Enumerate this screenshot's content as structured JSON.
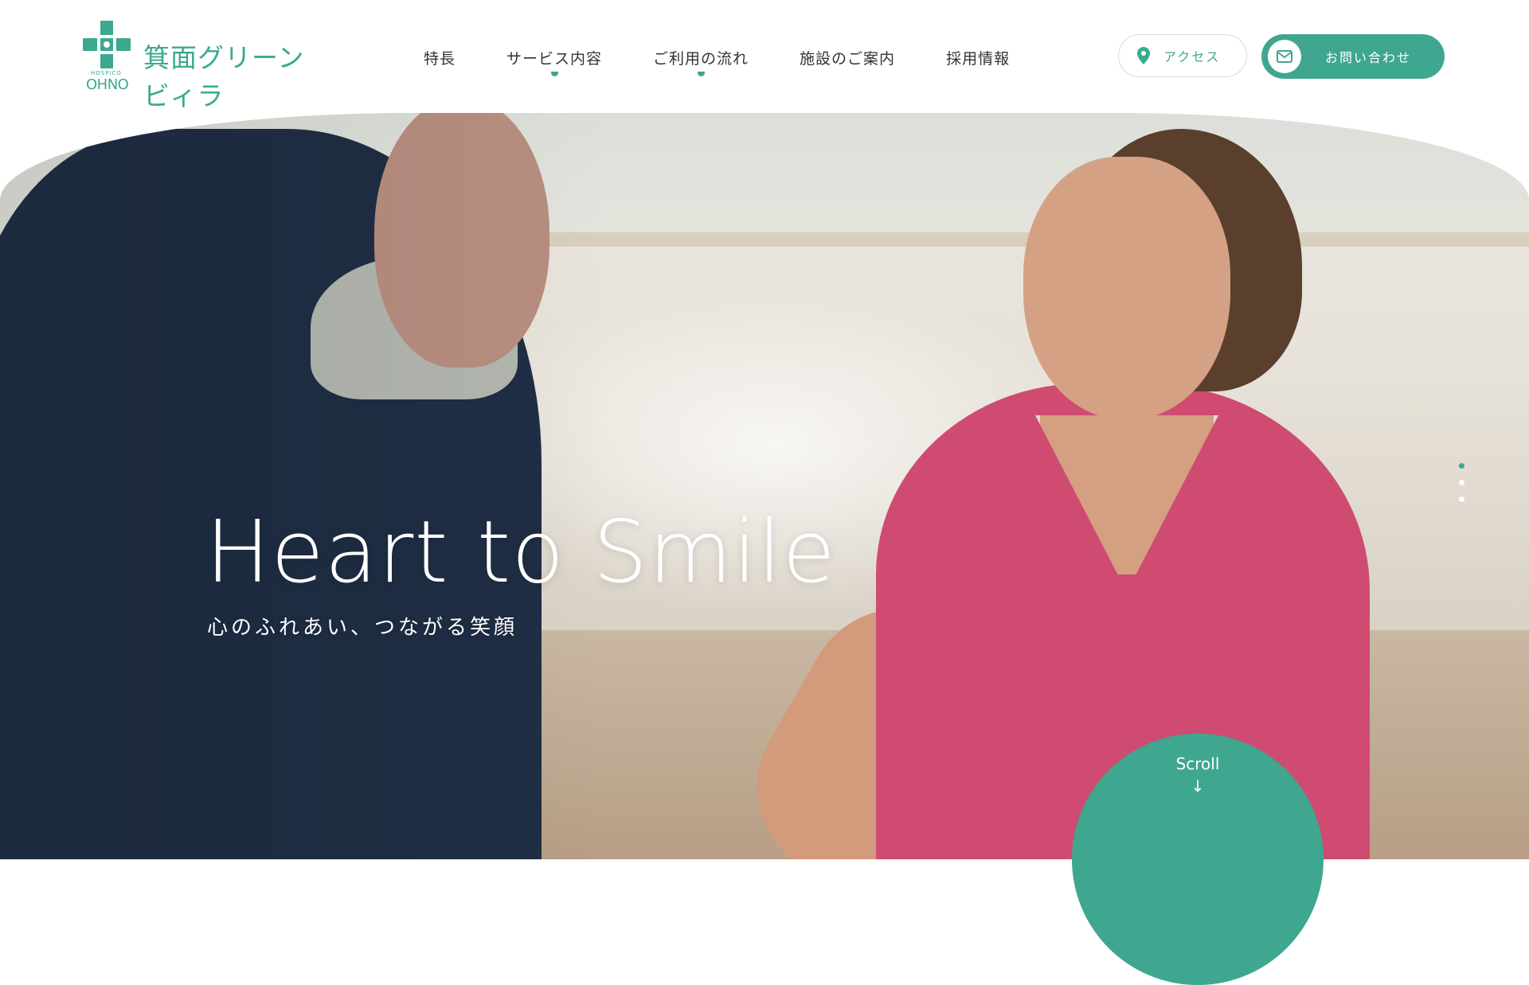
{
  "header": {
    "logo": {
      "mark_label": "logo-mark",
      "sub": "HOSPICO",
      "en": "OHNO",
      "jp": "箕面グリーンビィラ"
    },
    "nav": [
      {
        "label": "特長"
      },
      {
        "label": "サービス内容"
      },
      {
        "label": "ご利用の流れ"
      },
      {
        "label": "施設のご案内"
      },
      {
        "label": "採用情報"
      }
    ],
    "access_label": "アクセス",
    "contact_label": "お問い合わせ"
  },
  "hero": {
    "title": "Heart to Smile",
    "subtitle": "心のふれあい、つながる笑顔",
    "scroll_label": "Scroll",
    "scroll_arrow": "↓"
  },
  "colors": {
    "accent": "#3fa690",
    "text": "#333333",
    "white": "#ffffff"
  },
  "icons": {
    "access": "map-pin-icon",
    "contact": "mail-icon",
    "scroll": "arrow-down-icon"
  }
}
